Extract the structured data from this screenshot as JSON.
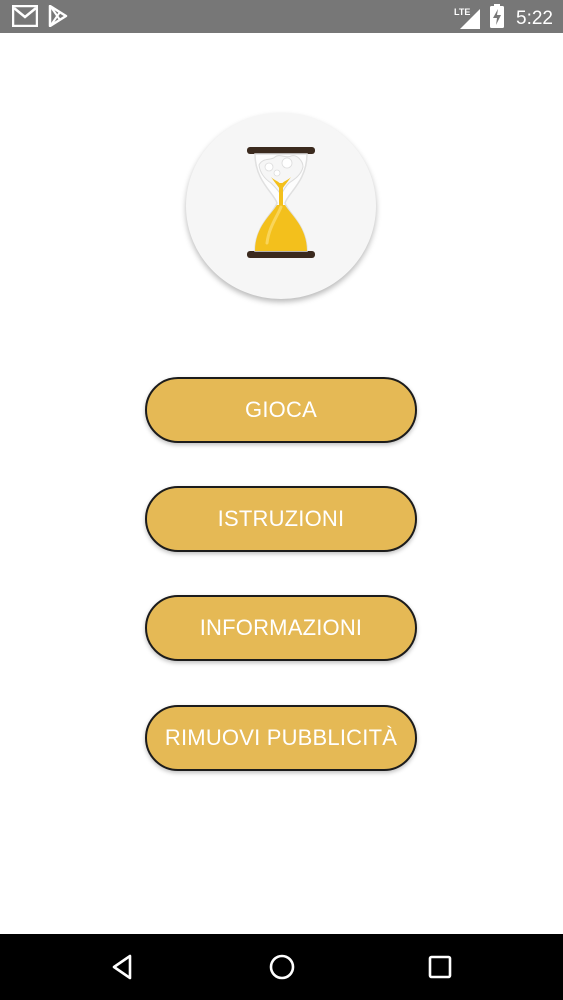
{
  "status_bar": {
    "time": "5:22",
    "network_type": "LTE",
    "left_icons": [
      "gmail-icon",
      "play-store-icon"
    ],
    "right_icons": [
      "lte-signal-icon",
      "battery-charging-icon"
    ]
  },
  "logo": {
    "icon": "hourglass-icon"
  },
  "menu": {
    "play_label": "GIOCA",
    "instructions_label": "ISTRUZIONI",
    "information_label": "INFORMAZIONI",
    "remove_ads_label": "RIMUOVI PUBBLICITÀ"
  },
  "nav_bar": {
    "icons": [
      "back-icon",
      "home-icon",
      "recents-icon"
    ]
  },
  "colors": {
    "status_bar": "#777777",
    "button_fill": "#e5b955",
    "button_border": "#1c1c1c",
    "button_text": "#ffffff",
    "nav_bar": "#000000",
    "sand": "#f3c01c",
    "hourglass_frame": "#3b2a1e"
  }
}
